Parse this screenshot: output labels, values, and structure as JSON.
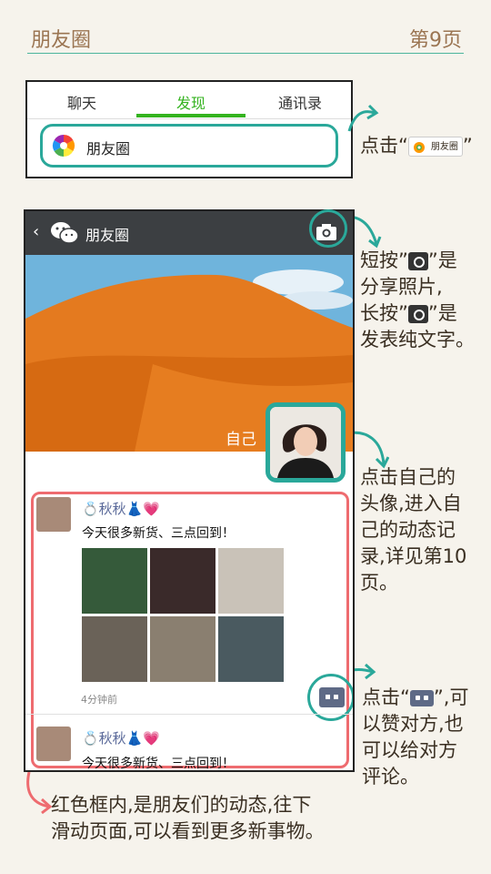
{
  "header": {
    "title": "朋友圈",
    "page": "第9页"
  },
  "tabs": [
    {
      "label": "聊天"
    },
    {
      "label": "发现",
      "active": true
    },
    {
      "label": "通讯录"
    }
  ],
  "entry": {
    "label": "朋友圈"
  },
  "phone": {
    "title": "朋友圈",
    "self_name": "自己",
    "posts": [
      {
        "name": "💍秋秋👗💗",
        "text": "今天很多新货、三点回到！",
        "time": "4分钟前",
        "photo_count": 6
      },
      {
        "name": "💍秋秋👗💗",
        "text": "今天很多新货、三点回到！"
      }
    ]
  },
  "notes": {
    "n1_prefix": "点击“",
    "n1_chip": "朋友圈",
    "n1_suffix": "”",
    "n2_l1a": "短按”",
    "n2_l1b": "”是",
    "n2_l2": "分享照片,",
    "n2_l3a": "长按”",
    "n2_l3b": "”是",
    "n2_l4": "发表纯文字。",
    "n3_l1": "点击自己的",
    "n3_l2": "头像,进入自",
    "n3_l3": "己的动态记",
    "n3_l4": "录,详见第10",
    "n3_l5": "页。",
    "n4_l1a": "点击“",
    "n4_l1b": "”,可",
    "n4_l2": "以赞对方,也",
    "n4_l3": "可以给对方",
    "n4_l4": "评论。",
    "n5_l1": "红色框内,是朋友们的动态,往下",
    "n5_l2": "滑动页面,可以看到更多新事物。"
  },
  "colors": {
    "accent": "#2aa89a",
    "wechat_green": "#34b31f",
    "feed_frame": "#ee6b6f",
    "heading": "#9b7552"
  }
}
